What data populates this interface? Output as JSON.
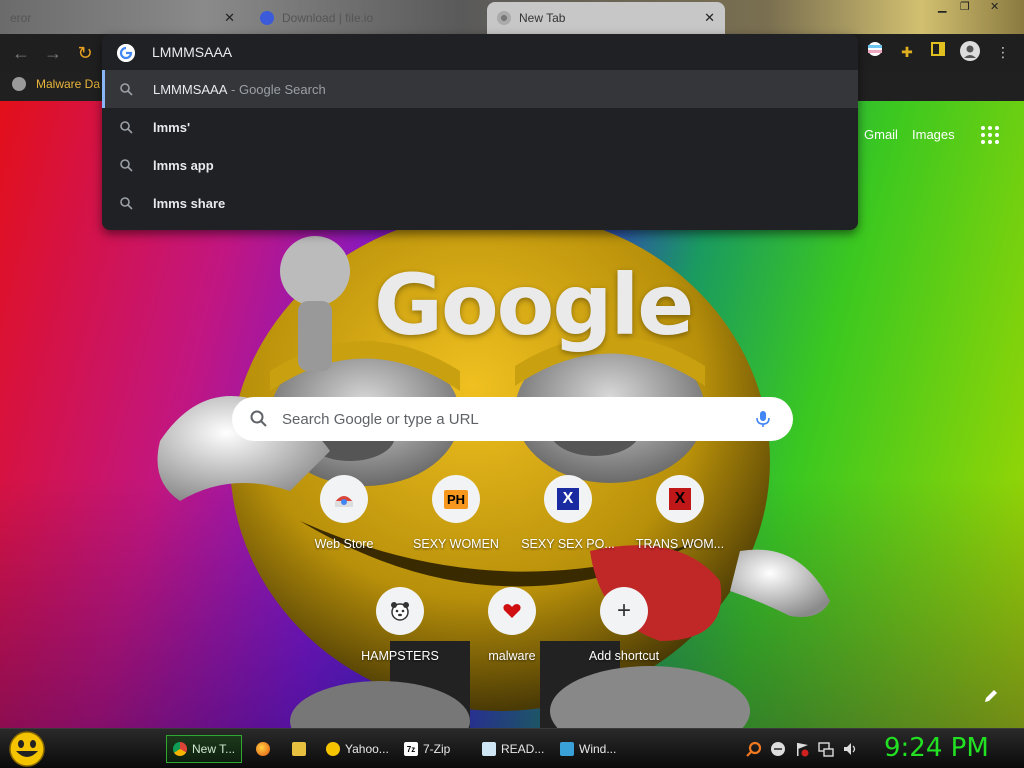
{
  "browser": {
    "tabs": [
      {
        "title": "eror",
        "active": false
      },
      {
        "title": "Download | file.io",
        "active": false
      },
      {
        "title": "New Tab",
        "active": true
      }
    ],
    "close_glyph": "✕",
    "omnibox": {
      "value": "LMMMSAAA",
      "suggestions": [
        {
          "text": "LMMMSAAA",
          "suffix": " - Google Search",
          "selected": true
        },
        {
          "text": "lmms'",
          "suffix": "",
          "selected": false
        },
        {
          "text": "lmms app",
          "suffix": "",
          "selected": false
        },
        {
          "text": "lmms share",
          "suffix": "",
          "selected": false
        }
      ]
    },
    "bookmarks": [
      {
        "label": "Malware Da"
      }
    ]
  },
  "newtab": {
    "gmail": "Gmail",
    "images": "Images",
    "logo": "Google",
    "search_placeholder": "Search Google or type a URL",
    "shortcuts": [
      {
        "label": "Web Store",
        "icon": "webstore-icon"
      },
      {
        "label": "SEXY WOMEN",
        "icon": "ph-icon",
        "badge": "PH"
      },
      {
        "label": "SEXY SEX PO...",
        "icon": "x-icon",
        "badge": "X"
      },
      {
        "label": "TRANS WOM...",
        "icon": "x-red-icon",
        "badge": "X"
      },
      {
        "label": "HAMPSTERS",
        "icon": "hamster-icon"
      },
      {
        "label": "malware",
        "icon": "heart-icon"
      },
      {
        "label": "Add shortcut",
        "icon": "plus-icon",
        "badge": "+"
      }
    ]
  },
  "taskbar": {
    "items": [
      {
        "label": "New T...",
        "icon": "chrome-icon",
        "active": true
      },
      {
        "label": "",
        "icon": "firefox-icon",
        "active": false
      },
      {
        "label": "",
        "icon": "folder-icon",
        "active": false
      },
      {
        "label": "Yahoo...",
        "icon": "yahoo-smiley-icon",
        "active": false
      },
      {
        "label": "7-Zip",
        "icon": "7zip-icon",
        "active": false,
        "badge": "7z"
      },
      {
        "label": "READ...",
        "icon": "notepad-icon",
        "active": false
      },
      {
        "label": "Wind...",
        "icon": "window-icon",
        "active": false
      }
    ],
    "clock": "9:24 PM"
  },
  "colors": {
    "omnibox_bg": "#202124",
    "selected_row": "#35363a",
    "accent_blue": "#8ab4f8",
    "clock_green": "#22e022",
    "bookmark_text": "#e8b53a"
  }
}
